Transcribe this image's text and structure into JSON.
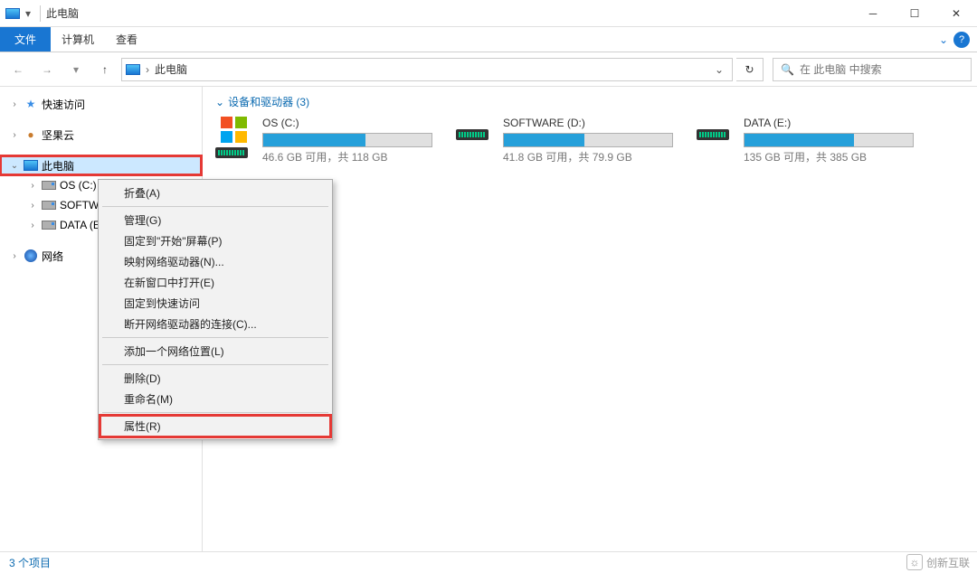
{
  "titlebar": {
    "title": "此电脑"
  },
  "menubar": {
    "file": "文件",
    "computer": "计算机",
    "view": "查看"
  },
  "toolbar": {
    "breadcrumb": "此电脑",
    "search_placeholder": "在 此电脑 中搜索"
  },
  "sidebar": {
    "quick_access": "快速访问",
    "nutcloud": "坚果云",
    "this_pc": "此电脑",
    "drives": [
      "OS (C:)",
      "SOFTWA…",
      "DATA (E:"
    ],
    "network": "网络"
  },
  "content": {
    "group_header": "设备和驱动器 (3)",
    "drives": [
      {
        "name": "OS (C:)",
        "free": "46.6 GB 可用，共 118 GB",
        "fill_pct": 61
      },
      {
        "name": "SOFTWARE (D:)",
        "free": "41.8 GB 可用，共 79.9 GB",
        "fill_pct": 48
      },
      {
        "name": "DATA (E:)",
        "free": "135 GB 可用，共 385 GB",
        "fill_pct": 65
      }
    ]
  },
  "context_menu": {
    "collapse": "折叠(A)",
    "manage": "管理(G)",
    "pin_start": "固定到\"开始\"屏幕(P)",
    "map_drive": "映射网络驱动器(N)...",
    "open_new": "在新窗口中打开(E)",
    "pin_qa": "固定到快速访问",
    "disconnect": "断开网络驱动器的连接(C)...",
    "add_loc": "添加一个网络位置(L)",
    "delete": "删除(D)",
    "rename": "重命名(M)",
    "properties": "属性(R)"
  },
  "statusbar": {
    "items": "3 个项目"
  },
  "watermark": "创新互联"
}
